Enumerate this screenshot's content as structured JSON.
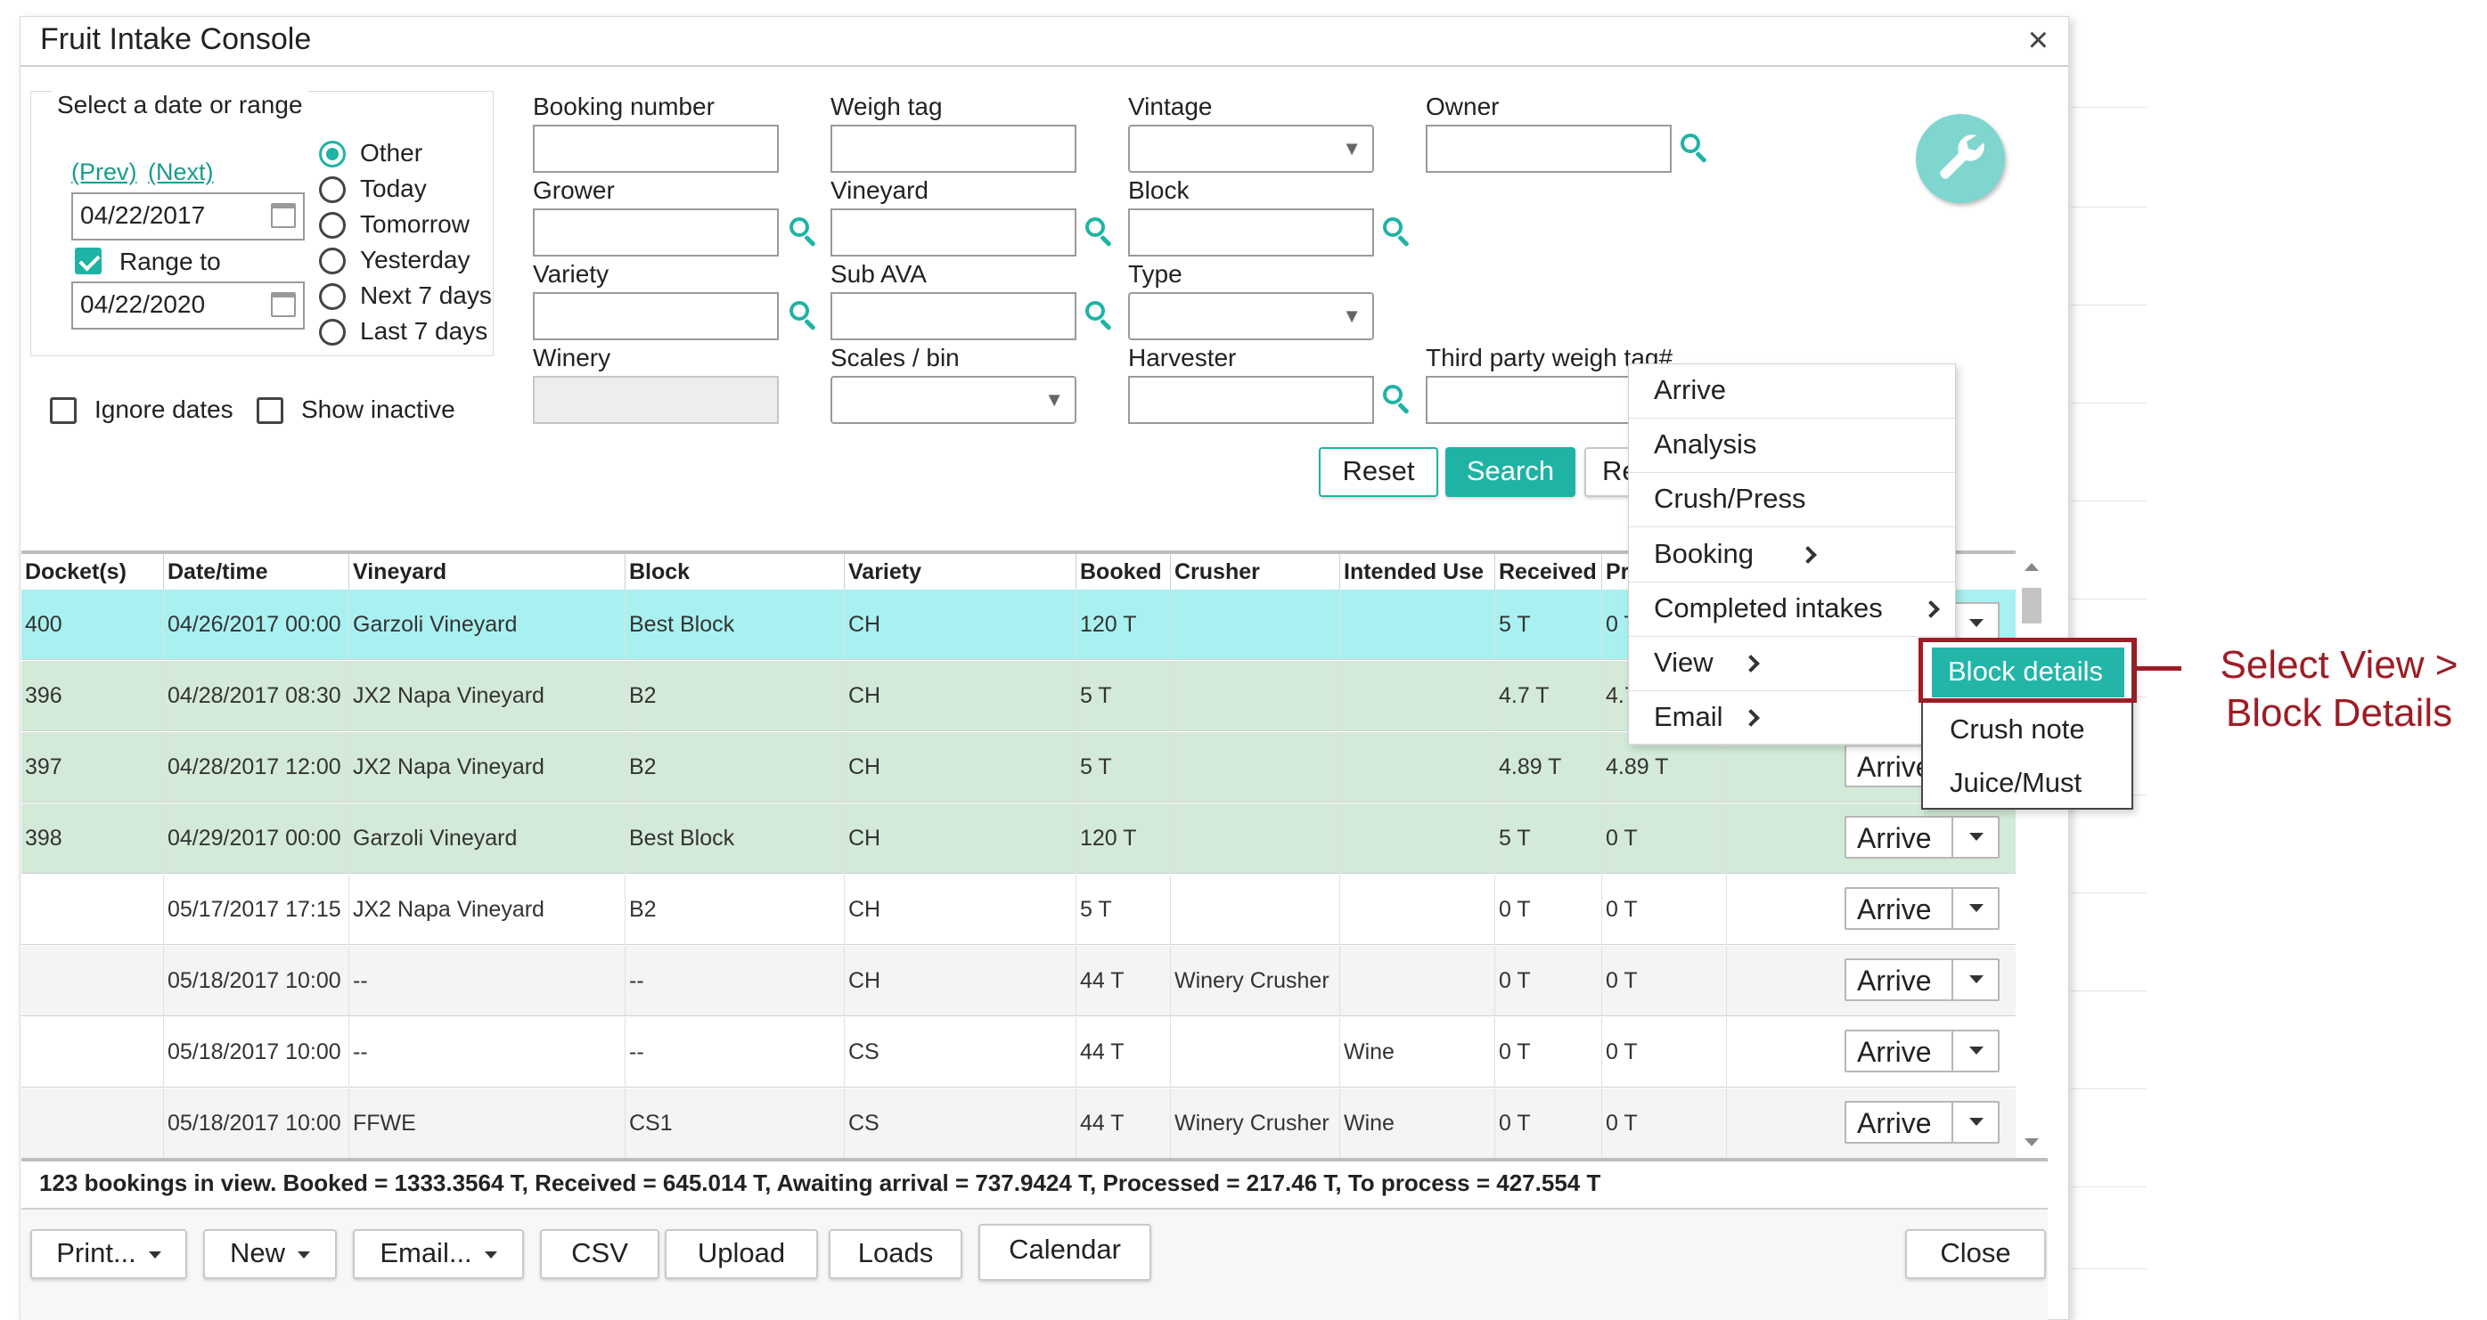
{
  "dialog": {
    "title": "Fruit Intake Console",
    "close_glyph": "×"
  },
  "date_filter": {
    "legend": "Select a date or range",
    "prev": "(Prev)",
    "next": "(Next)",
    "from": "04/22/2017",
    "range_to_label": "Range to",
    "range_to_checked": true,
    "to": "04/22/2020",
    "options": [
      "Other",
      "Today",
      "Tomorrow",
      "Yesterday",
      "Next 7 days",
      "Last 7 days"
    ],
    "selected_option": "Other",
    "ignore_dates": "Ignore dates",
    "show_inactive": "Show inactive"
  },
  "fields": {
    "booking_number": "Booking number",
    "weigh_tag": "Weigh tag",
    "vintage": "Vintage",
    "owner": "Owner",
    "grower": "Grower",
    "vineyard": "Vineyard",
    "block": "Block",
    "variety": "Variety",
    "sub_ava": "Sub AVA",
    "type": "Type",
    "winery": "Winery",
    "scales_bin": "Scales / bin",
    "harvester": "Harvester",
    "third_party": "Third party weigh tag#"
  },
  "actions": {
    "reset": "Reset",
    "search": "Search",
    "third": "Re"
  },
  "context_menu": {
    "items": [
      {
        "label": "Arrive",
        "submenu": false
      },
      {
        "label": "Analysis",
        "submenu": false
      },
      {
        "label": "Crush/Press",
        "submenu": false
      },
      {
        "label": "Booking",
        "submenu": true
      },
      {
        "label": "Completed intakes",
        "submenu": true
      },
      {
        "label": "View",
        "submenu": true
      },
      {
        "label": "Email",
        "submenu": true
      }
    ]
  },
  "view_submenu": {
    "items": [
      "Block details",
      "Crush note",
      "Juice/Must"
    ],
    "active": "Block details"
  },
  "annotation": {
    "line1": "Select View >",
    "line2": "Block Details",
    "color": "#9e1c25"
  },
  "table": {
    "columns": [
      "Docket(s)",
      "Date/time",
      "Vineyard",
      "Block",
      "Variety",
      "Booked",
      "Crusher",
      "Intended Use",
      "Received",
      "Pr"
    ],
    "arrive_label": "Arrive",
    "rows": [
      {
        "docket": "400",
        "datetime": "04/26/2017 00:00",
        "vineyard": "Garzoli Vineyard",
        "block": "Best Block",
        "variety": "CH",
        "booked": "120 T",
        "crusher": "",
        "use": "",
        "received": "5 T",
        "processed": "0 T",
        "status": "selected",
        "arrive_visible": true
      },
      {
        "docket": "396",
        "datetime": "04/28/2017 08:30",
        "vineyard": "JX2 Napa Vineyard",
        "block": "B2",
        "variety": "CH",
        "booked": "5 T",
        "crusher": "",
        "use": "",
        "received": "4.7 T",
        "processed": "4.7",
        "status": "arrived",
        "arrive_visible": false
      },
      {
        "docket": "397",
        "datetime": "04/28/2017 12:00",
        "vineyard": "JX2 Napa Vineyard",
        "block": "B2",
        "variety": "CH",
        "booked": "5 T",
        "crusher": "",
        "use": "",
        "received": "4.89 T",
        "processed": "4.89 T",
        "status": "arrived",
        "arrive_visible": true
      },
      {
        "docket": "398",
        "datetime": "04/29/2017 00:00",
        "vineyard": "Garzoli Vineyard",
        "block": "Best Block",
        "variety": "CH",
        "booked": "120 T",
        "crusher": "",
        "use": "",
        "received": "5 T",
        "processed": "0 T",
        "status": "arrived",
        "arrive_visible": true
      },
      {
        "docket": "",
        "datetime": "05/17/2017 17:15",
        "vineyard": "JX2 Napa Vineyard",
        "block": "B2",
        "variety": "CH",
        "booked": "5 T",
        "crusher": "",
        "use": "",
        "received": "0 T",
        "processed": "0 T",
        "status": "plain",
        "arrive_visible": true
      },
      {
        "docket": "",
        "datetime": "05/18/2017 10:00",
        "vineyard": "--",
        "block": "--",
        "variety": "CH",
        "booked": "44 T",
        "crusher": "Winery Crusher",
        "use": "",
        "received": "0 T",
        "processed": "0 T",
        "status": "alt",
        "arrive_visible": true
      },
      {
        "docket": "",
        "datetime": "05/18/2017 10:00",
        "vineyard": "--",
        "block": "--",
        "variety": "CS",
        "booked": "44 T",
        "crusher": "",
        "use": "Wine",
        "received": "0 T",
        "processed": "0 T",
        "status": "plain",
        "arrive_visible": true
      },
      {
        "docket": "",
        "datetime": "05/18/2017 10:00",
        "vineyard": "FFWE",
        "block": "CS1",
        "variety": "CS",
        "booked": "44 T",
        "crusher": "Winery Crusher",
        "use": "Wine",
        "received": "0 T",
        "processed": "0 T",
        "status": "alt",
        "arrive_visible": true
      }
    ]
  },
  "summary": "123 bookings in view. Booked = 1333.3564 T, Received = 645.014 T, Awaiting arrival = 737.9424 T, Processed = 217.46 T, To process = 427.554 T",
  "footer": {
    "print": "Print...",
    "new": "New",
    "email": "Email...",
    "csv": "CSV",
    "upload": "Upload",
    "loads": "Loads",
    "calendar": "Calendar",
    "close": "Close"
  },
  "colors": {
    "accent": "#1fb3a5",
    "selected_row": "#a9f1f0",
    "arrived_row": "#d3ead8",
    "annotation": "#9e1c25"
  },
  "icons": {
    "search": "search-icon",
    "calendar": "calendar-icon",
    "settings": "wrench-icon",
    "close": "close-icon"
  }
}
